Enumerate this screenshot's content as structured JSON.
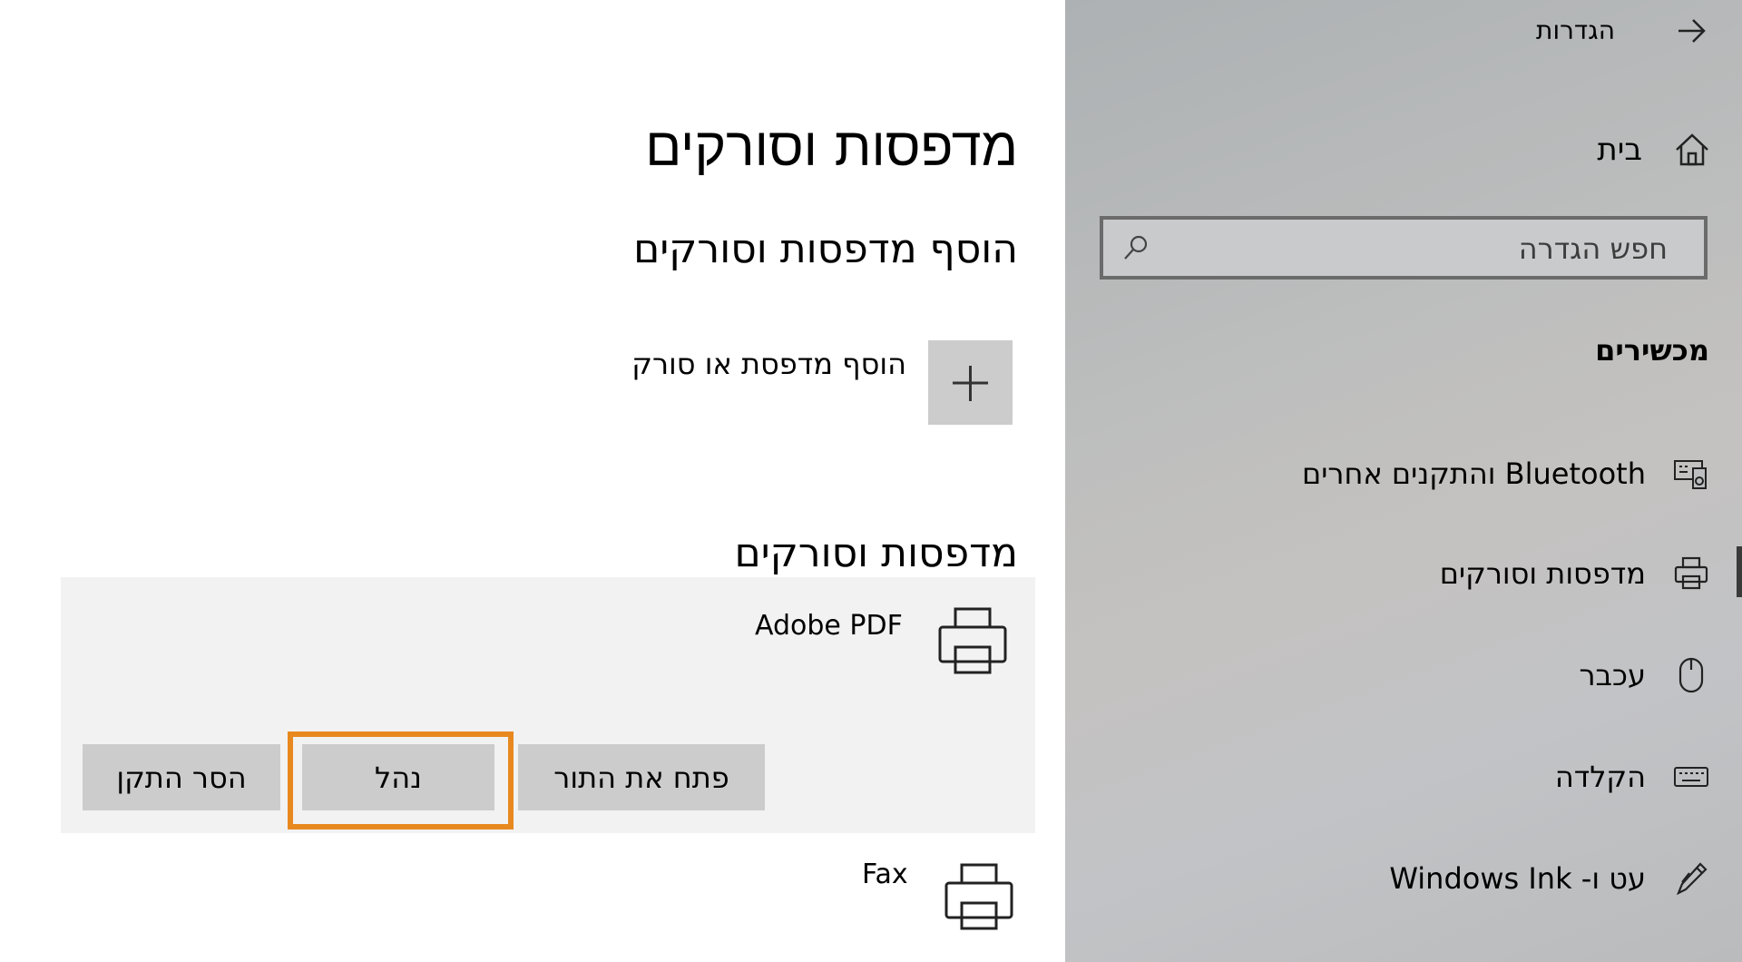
{
  "window": {
    "title": "הגדרות"
  },
  "sidebar": {
    "home_label": "בית",
    "search_placeholder": "חפש הגדרה",
    "section_title": "מכשירים",
    "items": [
      {
        "label": "Bluetooth והתקנים אחרים",
        "icon": "bluetooth-devices-icon"
      },
      {
        "label": "מדפסות וסורקים",
        "icon": "printer-icon",
        "selected": true
      },
      {
        "label": "עכבר",
        "icon": "mouse-icon"
      },
      {
        "label": "הקלדה",
        "icon": "keyboard-icon"
      },
      {
        "label": "עט ו- Windows Ink",
        "icon": "pen-icon"
      }
    ]
  },
  "main": {
    "page_title": "מדפסות וסורקים",
    "add_section_title": "הוסף מדפסות וסורקים",
    "add_button_label": "הוסף מדפסת או סורק",
    "list_section_title": "מדפסות וסורקים",
    "printers": [
      {
        "name": "Adobe PDF",
        "expanded": true,
        "actions": {
          "open_queue": "פתח את התור",
          "manage": "נהל",
          "remove": "הסר התקן"
        }
      },
      {
        "name": "Fax"
      }
    ]
  },
  "colors": {
    "highlight": "#e8891f",
    "sidebar_bg": "#bdbebf",
    "tile_bg": "#cccccc",
    "panel_bg": "#f2f2f2"
  }
}
